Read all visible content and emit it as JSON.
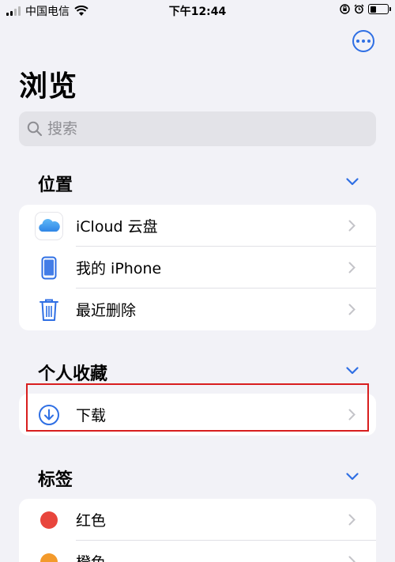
{
  "status_bar": {
    "carrier": "中国电信",
    "time": "下午12:44",
    "battery_level": 0.35
  },
  "header": {
    "title": "浏览",
    "more_icon": "ellipsis-circle-icon"
  },
  "search": {
    "placeholder": "搜索",
    "value": ""
  },
  "sections": {
    "locations": {
      "title": "位置",
      "items": [
        {
          "label": "iCloud 云盘",
          "icon": "icloud-icon"
        },
        {
          "label": "我的 iPhone",
          "icon": "iphone-icon"
        },
        {
          "label": "最近删除",
          "icon": "trash-icon"
        }
      ]
    },
    "favorites": {
      "title": "个人收藏",
      "items": [
        {
          "label": "下载",
          "icon": "download-icon"
        }
      ]
    },
    "tags": {
      "title": "标签",
      "items": [
        {
          "label": "红色",
          "color": "#e8453c"
        },
        {
          "label": "橙色",
          "color": "#f39a2b"
        }
      ]
    }
  },
  "colors": {
    "accent": "#2f6fe4",
    "highlight": "#d81e1e"
  }
}
